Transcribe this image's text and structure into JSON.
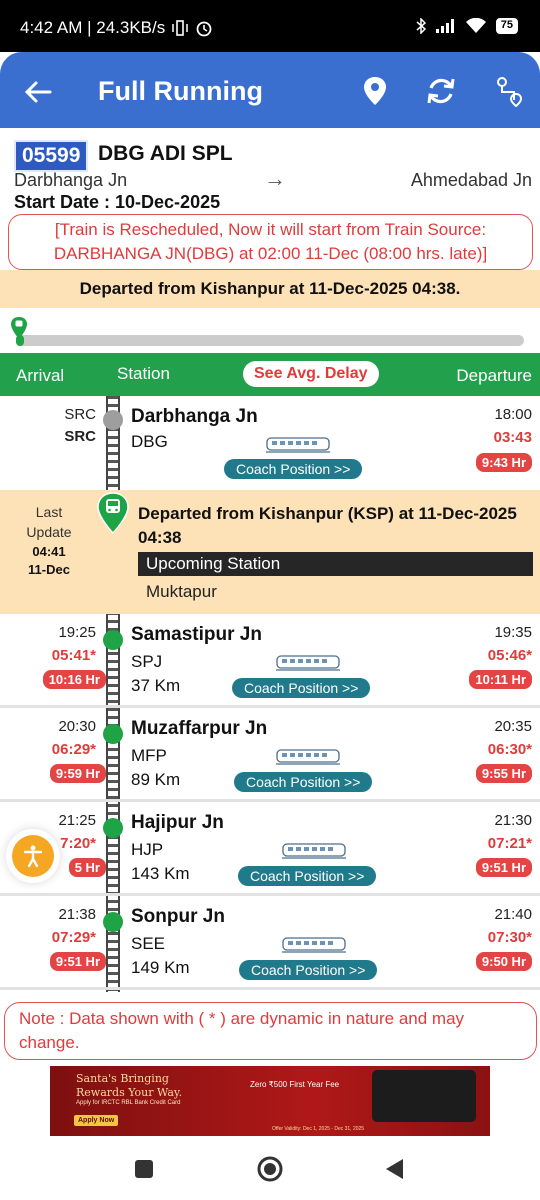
{
  "status_bar": {
    "time_speed": "4:42 AM | 24.3KB/s",
    "battery": "75"
  },
  "app_bar": {
    "title": "Full Running",
    "back_icon": "back-arrow-icon",
    "location_icon": "map-pin-icon",
    "refresh_icon": "refresh-icon",
    "route_icon": "route-icon",
    "color": "#3a6fcf"
  },
  "train": {
    "number": "05599",
    "name": "DBG ADI SPL",
    "source": "Darbhanga Jn",
    "destination": "Ahmedabad Jn",
    "arrow": "→",
    "start_date": "Start Date : 10-Dec-2025",
    "reschedule_notice": "[Train is Rescheduled, Now it will start from Train Source: DARBHANGA JN(DBG) at 02:00 11-Dec (08:00 hrs. late)]"
  },
  "departed_banner": "Departed from Kishanpur at 11-Dec-2025 04:38.",
  "progress": {
    "fraction": 0.01
  },
  "table_header": {
    "arrival": "Arrival",
    "station": "Station",
    "avg_delay_button": "See Avg. Delay",
    "departure": "Departure"
  },
  "source_row": {
    "arr_label": "SRC",
    "arr_label2": "SRC",
    "name": "Darbhanga Jn",
    "code": "DBG",
    "coach_button": "Coach Position >>",
    "dep_time": "18:00",
    "dep_actual": "03:43",
    "dep_delay": "9:43 Hr"
  },
  "last_update": {
    "label": "Last Update",
    "time": "04:41",
    "date": "11-Dec",
    "message": "Departed from Kishanpur (KSP) at 11-Dec-2025 04:38",
    "upcoming_label": "Upcoming Station",
    "upcoming_station": "Muktapur"
  },
  "stations": [
    {
      "arr_time": "19:25",
      "arr_actual": "05:41*",
      "arr_delay": "10:16 Hr",
      "name": "Samastipur Jn",
      "code": "SPJ",
      "km": "37 Km",
      "coach_button": "Coach Position >>",
      "dep_time": "19:35",
      "dep_actual": "05:46*",
      "dep_delay": "10:11 Hr"
    },
    {
      "arr_time": "20:30",
      "arr_actual": "06:29*",
      "arr_delay": "9:59 Hr",
      "name": "Muzaffarpur Jn",
      "code": "MFP",
      "km": "89 Km",
      "coach_button": "Coach Position >>",
      "dep_time": "20:35",
      "dep_actual": "06:30*",
      "dep_delay": "9:55 Hr"
    },
    {
      "arr_time": "21:25",
      "arr_actual": "7:20*",
      "arr_delay": "5 Hr",
      "name": "Hajipur Jn",
      "code": "HJP",
      "km": "143 Km",
      "coach_button": "Coach Position >>",
      "dep_time": "21:30",
      "dep_actual": "07:21*",
      "dep_delay": "9:51 Hr"
    },
    {
      "arr_time": "21:38",
      "arr_actual": "07:29*",
      "arr_delay": "9:51 Hr",
      "name": "Sonpur Jn",
      "code": "SEE",
      "km": "149 Km",
      "coach_button": "Coach Position >>",
      "dep_time": "21:40",
      "dep_actual": "07:30*",
      "dep_delay": "9:50 Hr"
    }
  ],
  "note": "Note : Data shown with ( * ) are dynamic in nature and may change.",
  "ad": {
    "line1": "Santa's Bringing",
    "line2": "Rewards Your Way.",
    "small": "Apply for IRCTC RBL Bank Credit Card",
    "apply": "Apply Now",
    "offer": "Zero ₹500 First Year Fee",
    "validity": "Offer Validity: Dec 1, 2025 - Dec 31, 2025"
  },
  "colors": {
    "green": "#1fa347",
    "header_green": "#22a04b",
    "late_red": "#e03b3b",
    "banner_peach": "#fde2b8"
  }
}
